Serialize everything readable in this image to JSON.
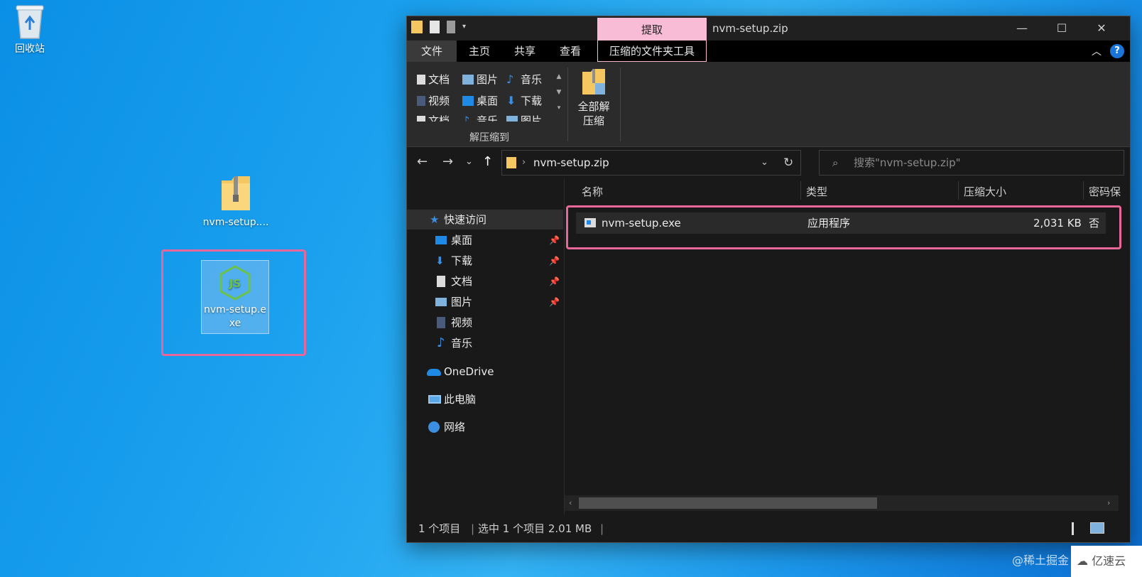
{
  "desktop": {
    "icons": [
      {
        "label": "回收站",
        "icon": "recycle-bin-icon"
      },
      {
        "label": "nvm-setup....",
        "icon": "zip-folder-icon"
      },
      {
        "label": "nvm-setup.exe",
        "icon": "nodejs-exe-icon"
      }
    ]
  },
  "window": {
    "title": "nvm-setup.zip",
    "context_tab_top": "提取",
    "controls": {
      "minimize": "—",
      "maximize": "☐",
      "close": "✕"
    },
    "tabs": [
      "文件",
      "主页",
      "共享",
      "查看",
      "压缩的文件夹工具"
    ],
    "help": "?"
  },
  "ribbon": {
    "gallery": [
      {
        "label": "文档",
        "icon": "document-icon"
      },
      {
        "label": "图片",
        "icon": "pictures-icon"
      },
      {
        "label": "音乐",
        "icon": "music-icon"
      },
      {
        "label": "视频",
        "icon": "video-icon"
      },
      {
        "label": "桌面",
        "icon": "desktop-icon"
      },
      {
        "label": "下载",
        "icon": "download-icon"
      },
      {
        "label": "文档",
        "icon": "document-icon"
      },
      {
        "label": "音乐",
        "icon": "music-icon"
      },
      {
        "label": "图片",
        "icon": "pictures-icon"
      }
    ],
    "group_label": "解压缩到",
    "extract_all": "全部解\n压缩",
    "extract_all_line1": "全部解",
    "extract_all_line2": "压缩"
  },
  "addressbar": {
    "path": "nvm-setup.zip",
    "search_placeholder": "搜索\"nvm-setup.zip\""
  },
  "navigation": {
    "items": [
      {
        "label": "快速访问",
        "icon": "star-pin-icon",
        "pinned": false
      },
      {
        "label": "桌面",
        "icon": "desktop-icon",
        "pinned": true
      },
      {
        "label": "下载",
        "icon": "download-icon",
        "pinned": true
      },
      {
        "label": "文档",
        "icon": "document-icon",
        "pinned": true
      },
      {
        "label": "图片",
        "icon": "pictures-icon",
        "pinned": true
      },
      {
        "label": "视频",
        "icon": "video-icon",
        "pinned": false
      },
      {
        "label": "音乐",
        "icon": "music-icon",
        "pinned": false
      },
      {
        "label": "OneDrive",
        "icon": "onedrive-icon",
        "pinned": false
      },
      {
        "label": "此电脑",
        "icon": "this-pc-icon",
        "pinned": false
      },
      {
        "label": "网络",
        "icon": "network-icon",
        "pinned": false
      }
    ]
  },
  "filelist": {
    "columns": [
      "名称",
      "类型",
      "压缩大小",
      "密码保"
    ],
    "rows": [
      {
        "name": "nvm-setup.exe",
        "type": "应用程序",
        "size": "2,031 KB",
        "password": "否"
      }
    ]
  },
  "status": {
    "count": "1 个项目",
    "selected": "选中 1 个项目 2.01 MB"
  },
  "watermarks": {
    "left": "@稀土掘金",
    "right": "亿速云"
  },
  "colors": {
    "highlight": "#e8679b",
    "context_tab": "#f8bcd6",
    "window_bg": "#191919",
    "desktop_blue": "#1aa0ee"
  }
}
